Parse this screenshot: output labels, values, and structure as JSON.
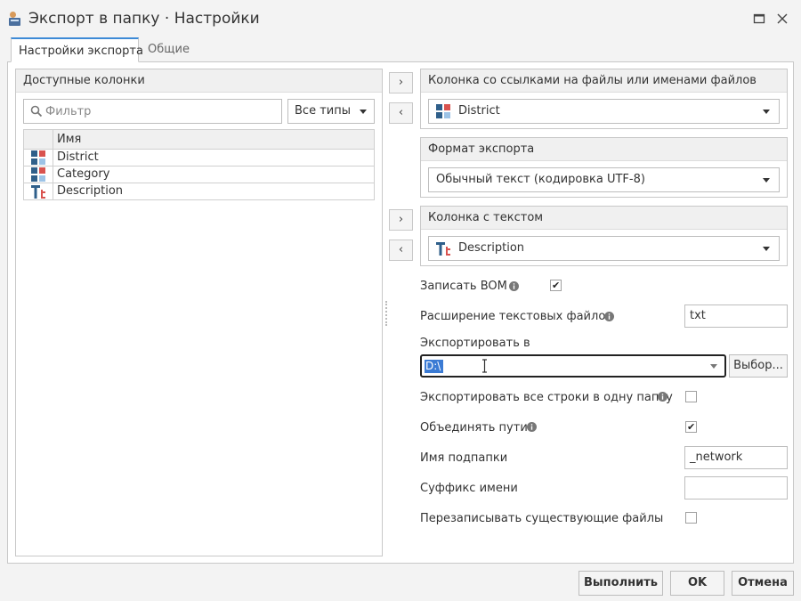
{
  "window": {
    "title": "Экспорт в папку · Настройки"
  },
  "tabs": [
    {
      "label": "Настройки экспорта",
      "active": true
    },
    {
      "label": "Общие",
      "active": false
    }
  ],
  "available_columns": {
    "header": "Доступные колонки",
    "filter_placeholder": "Фильтр",
    "types_select": "Все типы",
    "grid_header": "Имя",
    "rows": [
      {
        "name": "District",
        "icon": "categorical-column-icon"
      },
      {
        "name": "Category",
        "icon": "categorical-column-icon"
      },
      {
        "name": "Description",
        "icon": "text-column-icon"
      }
    ]
  },
  "arrows": {
    "add": "›",
    "remove": "‹"
  },
  "file_column": {
    "header": "Колонка со ссылками на файлы или именами файлов",
    "value": "District",
    "icon": "categorical-column-icon"
  },
  "export_format": {
    "header": "Формат экспорта",
    "value": "Обычный текст (кодировка UTF-8)"
  },
  "text_column": {
    "header": "Колонка с текстом",
    "value": "Description",
    "icon": "text-column-icon"
  },
  "options": {
    "write_bom": {
      "label": "Записать BOM",
      "checked": true
    },
    "file_extension": {
      "label": "Расширение текстовых файлов",
      "value": "txt"
    },
    "export_to": {
      "label": "Экспортировать в",
      "value": "D:\\",
      "browse_label": "Выбор..."
    },
    "single_folder": {
      "label": "Экспортировать все строки в одну папку",
      "checked": false
    },
    "merge_paths": {
      "label": "Объединять пути",
      "checked": true
    },
    "subfolder_name": {
      "label": "Имя подпапки",
      "value": "_network"
    },
    "name_suffix": {
      "label": "Суффикс имени",
      "value": ""
    },
    "overwrite": {
      "label": "Перезаписывать существующие файлы",
      "checked": false
    }
  },
  "footer": {
    "run": "Выполнить",
    "ok": "OK",
    "cancel": "Отмена"
  },
  "colors": {
    "accent": "#3d8ad6",
    "selection": "#3b7bd4",
    "icon_blue": "#2f5f8a",
    "icon_red": "#d9534f",
    "icon_light_blue": "#9dc3e6"
  }
}
